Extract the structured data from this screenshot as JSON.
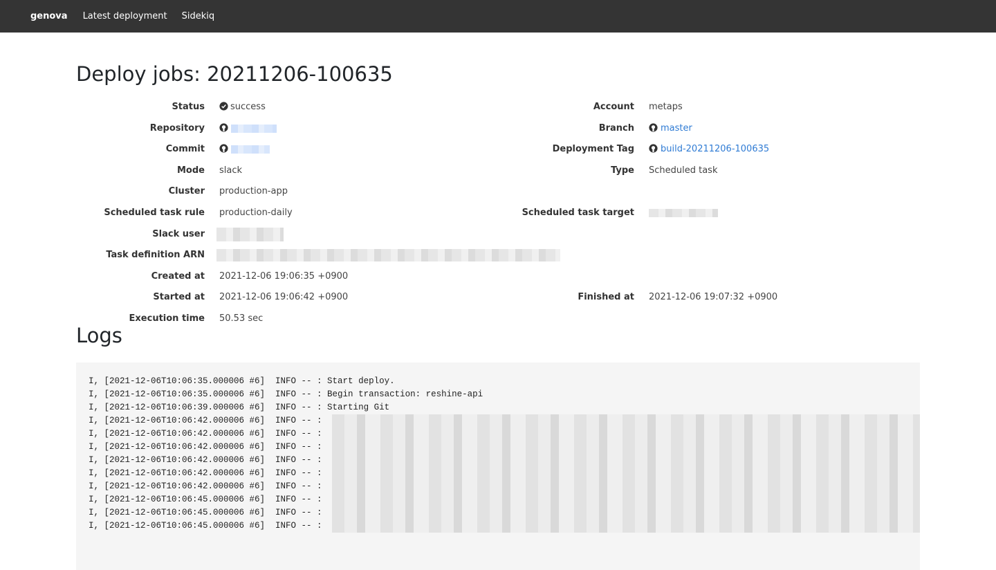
{
  "navbar": {
    "brand": "genova",
    "links": [
      "Latest deployment",
      "Sidekiq"
    ]
  },
  "page": {
    "title": "Deploy jobs: 20211206-100635"
  },
  "details": {
    "status_label": "Status",
    "status_value": "success",
    "account_label": "Account",
    "account_value": "metaps",
    "repository_label": "Repository",
    "branch_label": "Branch",
    "branch_value": "master",
    "commit_label": "Commit",
    "deployment_tag_label": "Deployment Tag",
    "deployment_tag_value": "build-20211206-100635",
    "mode_label": "Mode",
    "mode_value": "slack",
    "type_label": "Type",
    "type_value": "Scheduled task",
    "cluster_label": "Cluster",
    "cluster_value": "production-app",
    "scheduled_rule_label": "Scheduled task rule",
    "scheduled_rule_value": "production-daily",
    "scheduled_target_label": "Scheduled task target",
    "slack_user_label": "Slack user",
    "task_def_label": "Task definition ARN",
    "created_label": "Created at",
    "created_value": "2021-12-06 19:06:35 +0900",
    "started_label": "Started at",
    "started_value": "2021-12-06 19:06:42 +0900",
    "finished_label": "Finished at",
    "finished_value": "2021-12-06 19:07:32 +0900",
    "execution_label": "Execution time",
    "execution_value": "50.53 sec"
  },
  "logs": {
    "title": "Logs",
    "lines": [
      "I, [2021-12-06T10:06:35.000006 #6]  INFO -- : Start deploy.",
      "I, [2021-12-06T10:06:35.000006 #6]  INFO -- : Begin transaction: reshine-api",
      "I, [2021-12-06T10:06:39.000006 #6]  INFO -- : Starting Git",
      "I, [2021-12-06T10:06:42.000006 #6]  INFO -- :",
      "I, [2021-12-06T10:06:42.000006 #6]  INFO -- :",
      "I, [2021-12-06T10:06:42.000006 #6]  INFO -- :",
      "I, [2021-12-06T10:06:42.000006 #6]  INFO -- :",
      "I, [2021-12-06T10:06:42.000006 #6]  INFO -- :",
      "I, [2021-12-06T10:06:42.000006 #6]  INFO -- :",
      "I, [2021-12-06T10:06:45.000006 #6]  INFO -- :",
      "I, [2021-12-06T10:06:45.000006 #6]  INFO -- :",
      "I, [2021-12-06T10:06:45.000006 #6]  INFO -- :"
    ]
  },
  "icons": {
    "status": "check-circle-icon",
    "repo": "github-icon"
  }
}
